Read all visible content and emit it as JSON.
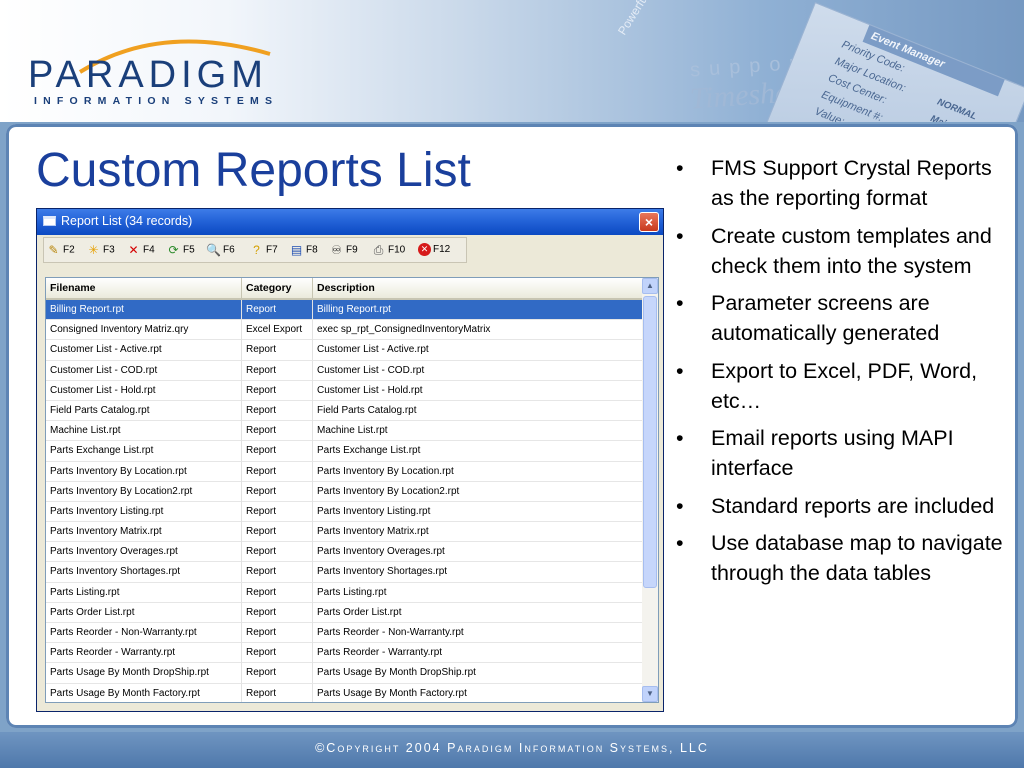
{
  "header": {
    "logo_word": "PARADIGM",
    "logo_sub": "INFORMATION SYSTEMS",
    "deco_support": "support",
    "deco_timesheets": "Timesheets",
    "deco_tagline": "Powerful Scalable",
    "card_title": "Event Manager",
    "card_lines": [
      "Priority Code:",
      "Major Location:",
      "Cost Center:",
      "Equipment #:",
      "Value:"
    ],
    "card_value_1": "NORMAL",
    "card_value_2": "Mai"
  },
  "slide": {
    "title": "Custom Reports List"
  },
  "window": {
    "title": "Report List (34 records)",
    "close_label": "×",
    "toolbar": [
      {
        "icon": "pencil-icon",
        "glyph": "✎",
        "color": "#b8860b",
        "label": "F2"
      },
      {
        "icon": "star-icon",
        "glyph": "✳",
        "color": "#e6a000",
        "label": "F3"
      },
      {
        "icon": "delete-x-icon",
        "glyph": "✕",
        "color": "#d40000",
        "label": "F4"
      },
      {
        "icon": "refresh-icon",
        "glyph": "⟳",
        "color": "#2a8a2a",
        "label": "F5"
      },
      {
        "icon": "print-preview-icon",
        "glyph": "🔍",
        "color": "#444444",
        "label": "F6"
      },
      {
        "icon": "help-icon",
        "glyph": "?",
        "color": "#d4a000",
        "label": "F7"
      },
      {
        "icon": "document-icon",
        "glyph": "▤",
        "color": "#1f4fb3",
        "label": "F8"
      },
      {
        "icon": "binoculars-icon",
        "glyph": "♾",
        "color": "#222222",
        "label": "F9"
      },
      {
        "icon": "printer-icon",
        "glyph": "⎙",
        "color": "#555555",
        "label": "F10"
      },
      {
        "icon": "exit-icon",
        "glyph": "✕",
        "color": "#ffffff",
        "label": "F12"
      }
    ],
    "columns": [
      "Filename",
      "Category",
      "Description"
    ],
    "rows": [
      [
        "Billing Report.rpt",
        "Report",
        "Billing Report.rpt"
      ],
      [
        "Consigned Inventory Matriz.qry",
        "Excel Export",
        "exec sp_rpt_ConsignedInventoryMatrix"
      ],
      [
        "Customer List - Active.rpt",
        "Report",
        "Customer List - Active.rpt"
      ],
      [
        "Customer List - COD.rpt",
        "Report",
        "Customer List - COD.rpt"
      ],
      [
        "Customer List - Hold.rpt",
        "Report",
        "Customer List - Hold.rpt"
      ],
      [
        "Field Parts Catalog.rpt",
        "Report",
        "Field Parts Catalog.rpt"
      ],
      [
        "Machine List.rpt",
        "Report",
        "Machine List.rpt"
      ],
      [
        "Parts Exchange List.rpt",
        "Report",
        "Parts Exchange List.rpt"
      ],
      [
        "Parts Inventory By Location.rpt",
        "Report",
        "Parts Inventory By Location.rpt"
      ],
      [
        "Parts Inventory By Location2.rpt",
        "Report",
        "Parts Inventory By Location2.rpt"
      ],
      [
        "Parts Inventory Listing.rpt",
        "Report",
        "Parts Inventory Listing.rpt"
      ],
      [
        "Parts Inventory Matrix.rpt",
        "Report",
        "Parts Inventory Matrix.rpt"
      ],
      [
        "Parts Inventory Overages.rpt",
        "Report",
        "Parts Inventory Overages.rpt"
      ],
      [
        "Parts Inventory Shortages.rpt",
        "Report",
        "Parts Inventory Shortages.rpt"
      ],
      [
        "Parts Listing.rpt",
        "Report",
        "Parts Listing.rpt"
      ],
      [
        "Parts Order List.rpt",
        "Report",
        "Parts Order List.rpt"
      ],
      [
        "Parts Reorder - Non-Warranty.rpt",
        "Report",
        "Parts Reorder - Non-Warranty.rpt"
      ],
      [
        "Parts Reorder - Warranty.rpt",
        "Report",
        "Parts Reorder - Warranty.rpt"
      ],
      [
        "Parts Usage By Month DropShip.rpt",
        "Report",
        "Parts Usage By Month DropShip.rpt"
      ],
      [
        "Parts Usage By Month Factory.rpt",
        "Report",
        "Parts Usage By Month Factory.rpt"
      ]
    ],
    "selected_row": 0,
    "selection_color": "#316ac5"
  },
  "bullets": [
    "FMS Support Crystal Reports as the reporting format",
    "Create custom templates and check them into the system",
    "Parameter screens are automatically generated",
    "Export to Excel, PDF, Word, etc…",
    "Email reports using MAPI interface",
    "Standard reports are included",
    "Use database map to navigate through the data tables"
  ],
  "bullet_glyph": "•",
  "footer": {
    "text": "©Copyright 2004 Paradigm Information Systems, LLC"
  }
}
